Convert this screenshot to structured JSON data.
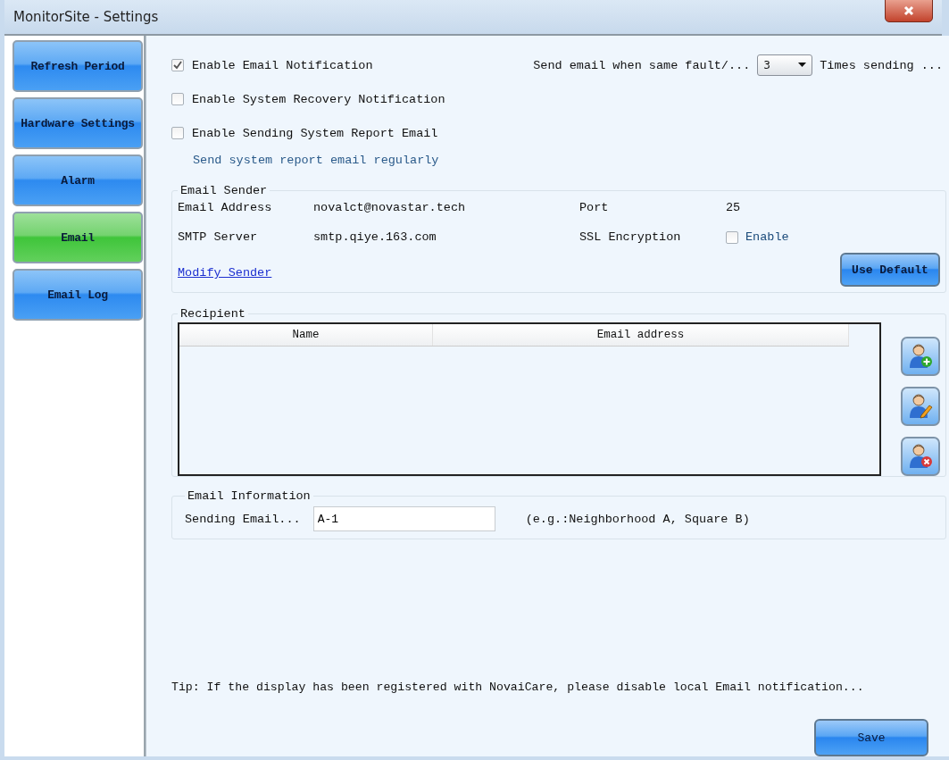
{
  "window": {
    "title": "MonitorSite - Settings"
  },
  "sidebar": {
    "items": [
      {
        "label": "Refresh Period",
        "selected": false
      },
      {
        "label": "Hardware Settings",
        "selected": false
      },
      {
        "label": "Alarm",
        "selected": false
      },
      {
        "label": "Email",
        "selected": true
      },
      {
        "label": "Email Log",
        "selected": false
      }
    ]
  },
  "notifications": {
    "options": [
      {
        "label": "Enable Email Notification",
        "checked": true
      },
      {
        "label": "Enable System Recovery Notification",
        "checked": false
      },
      {
        "label": "Enable Sending System Report Email",
        "checked": false
      }
    ],
    "report_hint": "Send system report email regularly",
    "repeat": {
      "label": "Send email when same fault/...",
      "value": "3",
      "suffix": "Times sending ..."
    }
  },
  "email_sender": {
    "title": "Email Sender",
    "fields": [
      {
        "label": "Email Address",
        "value": "novalct@novastar.tech"
      },
      {
        "label": "Port",
        "value": "25"
      },
      {
        "label": "SMTP Server",
        "value": "smtp.qiye.163.com"
      }
    ],
    "ssl": {
      "label": "SSL Encryption",
      "option": "Enable",
      "checked": false
    },
    "modify_link": "Modify Sender",
    "default_button": "Use Default"
  },
  "recipient": {
    "title": "Recipient",
    "table": {
      "columns": [
        "Name",
        "Email address"
      ]
    },
    "actions": [
      {
        "kind": "add"
      },
      {
        "kind": "edit"
      },
      {
        "kind": "remove"
      }
    ]
  },
  "email_information": {
    "title": "Email Information",
    "label": "Sending Email...",
    "value": "A-1",
    "hint": "(e.g.:Neighborhood A, Square B)"
  },
  "tip": "Tip: If the display has been registered with NovaiCare, please disable local Email notification...",
  "save_button": "Save"
}
